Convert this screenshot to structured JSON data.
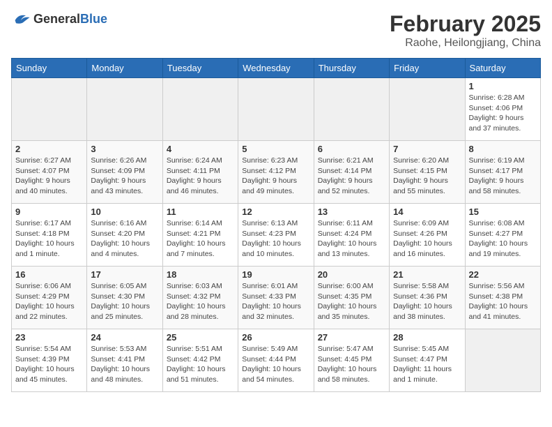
{
  "header": {
    "logo_general": "General",
    "logo_blue": "Blue",
    "title": "February 2025",
    "subtitle": "Raohe, Heilongjiang, China"
  },
  "days_of_week": [
    "Sunday",
    "Monday",
    "Tuesday",
    "Wednesday",
    "Thursday",
    "Friday",
    "Saturday"
  ],
  "weeks": [
    [
      {
        "day": "",
        "info": ""
      },
      {
        "day": "",
        "info": ""
      },
      {
        "day": "",
        "info": ""
      },
      {
        "day": "",
        "info": ""
      },
      {
        "day": "",
        "info": ""
      },
      {
        "day": "",
        "info": ""
      },
      {
        "day": "1",
        "info": "Sunrise: 6:28 AM\nSunset: 4:06 PM\nDaylight: 9 hours and 37 minutes."
      }
    ],
    [
      {
        "day": "2",
        "info": "Sunrise: 6:27 AM\nSunset: 4:07 PM\nDaylight: 9 hours and 40 minutes."
      },
      {
        "day": "3",
        "info": "Sunrise: 6:26 AM\nSunset: 4:09 PM\nDaylight: 9 hours and 43 minutes."
      },
      {
        "day": "4",
        "info": "Sunrise: 6:24 AM\nSunset: 4:11 PM\nDaylight: 9 hours and 46 minutes."
      },
      {
        "day": "5",
        "info": "Sunrise: 6:23 AM\nSunset: 4:12 PM\nDaylight: 9 hours and 49 minutes."
      },
      {
        "day": "6",
        "info": "Sunrise: 6:21 AM\nSunset: 4:14 PM\nDaylight: 9 hours and 52 minutes."
      },
      {
        "day": "7",
        "info": "Sunrise: 6:20 AM\nSunset: 4:15 PM\nDaylight: 9 hours and 55 minutes."
      },
      {
        "day": "8",
        "info": "Sunrise: 6:19 AM\nSunset: 4:17 PM\nDaylight: 9 hours and 58 minutes."
      }
    ],
    [
      {
        "day": "9",
        "info": "Sunrise: 6:17 AM\nSunset: 4:18 PM\nDaylight: 10 hours and 1 minute."
      },
      {
        "day": "10",
        "info": "Sunrise: 6:16 AM\nSunset: 4:20 PM\nDaylight: 10 hours and 4 minutes."
      },
      {
        "day": "11",
        "info": "Sunrise: 6:14 AM\nSunset: 4:21 PM\nDaylight: 10 hours and 7 minutes."
      },
      {
        "day": "12",
        "info": "Sunrise: 6:13 AM\nSunset: 4:23 PM\nDaylight: 10 hours and 10 minutes."
      },
      {
        "day": "13",
        "info": "Sunrise: 6:11 AM\nSunset: 4:24 PM\nDaylight: 10 hours and 13 minutes."
      },
      {
        "day": "14",
        "info": "Sunrise: 6:09 AM\nSunset: 4:26 PM\nDaylight: 10 hours and 16 minutes."
      },
      {
        "day": "15",
        "info": "Sunrise: 6:08 AM\nSunset: 4:27 PM\nDaylight: 10 hours and 19 minutes."
      }
    ],
    [
      {
        "day": "16",
        "info": "Sunrise: 6:06 AM\nSunset: 4:29 PM\nDaylight: 10 hours and 22 minutes."
      },
      {
        "day": "17",
        "info": "Sunrise: 6:05 AM\nSunset: 4:30 PM\nDaylight: 10 hours and 25 minutes."
      },
      {
        "day": "18",
        "info": "Sunrise: 6:03 AM\nSunset: 4:32 PM\nDaylight: 10 hours and 28 minutes."
      },
      {
        "day": "19",
        "info": "Sunrise: 6:01 AM\nSunset: 4:33 PM\nDaylight: 10 hours and 32 minutes."
      },
      {
        "day": "20",
        "info": "Sunrise: 6:00 AM\nSunset: 4:35 PM\nDaylight: 10 hours and 35 minutes."
      },
      {
        "day": "21",
        "info": "Sunrise: 5:58 AM\nSunset: 4:36 PM\nDaylight: 10 hours and 38 minutes."
      },
      {
        "day": "22",
        "info": "Sunrise: 5:56 AM\nSunset: 4:38 PM\nDaylight: 10 hours and 41 minutes."
      }
    ],
    [
      {
        "day": "23",
        "info": "Sunrise: 5:54 AM\nSunset: 4:39 PM\nDaylight: 10 hours and 45 minutes."
      },
      {
        "day": "24",
        "info": "Sunrise: 5:53 AM\nSunset: 4:41 PM\nDaylight: 10 hours and 48 minutes."
      },
      {
        "day": "25",
        "info": "Sunrise: 5:51 AM\nSunset: 4:42 PM\nDaylight: 10 hours and 51 minutes."
      },
      {
        "day": "26",
        "info": "Sunrise: 5:49 AM\nSunset: 4:44 PM\nDaylight: 10 hours and 54 minutes."
      },
      {
        "day": "27",
        "info": "Sunrise: 5:47 AM\nSunset: 4:45 PM\nDaylight: 10 hours and 58 minutes."
      },
      {
        "day": "28",
        "info": "Sunrise: 5:45 AM\nSunset: 4:47 PM\nDaylight: 11 hours and 1 minute."
      },
      {
        "day": "",
        "info": ""
      }
    ]
  ]
}
